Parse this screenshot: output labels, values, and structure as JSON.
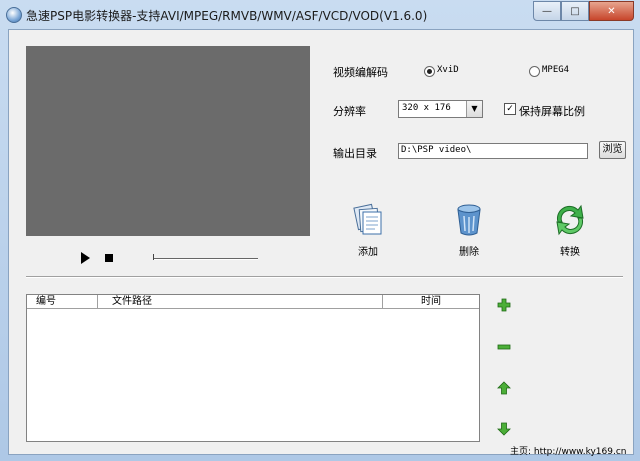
{
  "window": {
    "title": "急速PSP电影转换器-支持AVI/MPEG/RMVB/WMV/ASF/VCD/VOD(V1.6.0)"
  },
  "settings": {
    "codec_label": "视频编解码",
    "codec_options": [
      "XviD",
      "MPEG4"
    ],
    "codec_selected": "XviD",
    "resolution_label": "分辨率",
    "resolution_value": "320 x 176",
    "keep_ratio_label": "保持屏幕比例",
    "keep_ratio_checked": true,
    "output_label": "输出目录",
    "output_value": "D:\\PSP video\\",
    "browse_label": "浏览"
  },
  "actions": {
    "add": "添加",
    "delete": "删除",
    "convert": "转换"
  },
  "table": {
    "columns": [
      "编号",
      "文件路径",
      "时间"
    ],
    "rows": []
  },
  "footer": {
    "homepage": "主页: http://www.ky169.cn"
  },
  "icons": [
    "play-icon",
    "stop-icon",
    "add-files-icon",
    "trash-icon",
    "convert-icon",
    "plus-icon",
    "minus-icon",
    "up-arrow-icon",
    "down-arrow-icon"
  ]
}
